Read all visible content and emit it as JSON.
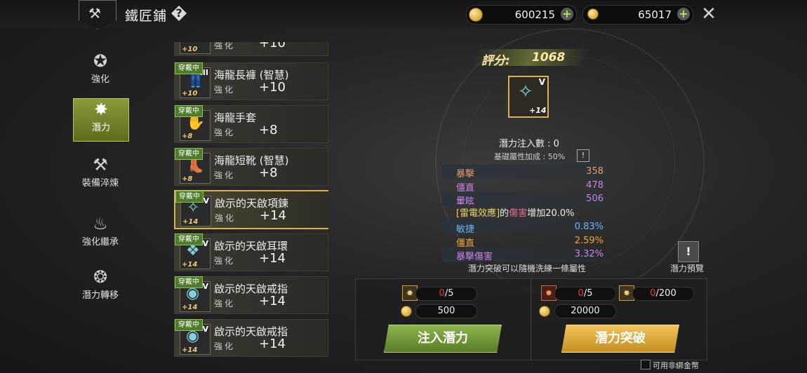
{
  "header": {
    "title": "鐵匠鋪",
    "help": "?",
    "gold": "600215",
    "gold_plus": "+",
    "gem": "65017",
    "gem_plus": "+"
  },
  "nav": [
    {
      "label": "強化",
      "icon": "enhance-icon"
    },
    {
      "label": "潛力",
      "icon": "potential-icon"
    },
    {
      "label": "裝備淬煉",
      "icon": "anvil-icon"
    },
    {
      "label": "強化繼承",
      "icon": "inherit-icon"
    },
    {
      "label": "潛力轉移",
      "icon": "transfer-icon"
    }
  ],
  "items": [
    {
      "tag": "",
      "name": "",
      "sub": "強化",
      "val": "+10",
      "lv": "+10",
      "tier": ""
    },
    {
      "tag": "穿戴中",
      "name": "海龍長褲 (智慧)",
      "sub": "強化",
      "val": "+10",
      "lv": "+10",
      "tier": "III"
    },
    {
      "tag": "穿戴中",
      "name": "海龍手套",
      "sub": "強化",
      "val": "+8",
      "lv": "+8",
      "tier": ""
    },
    {
      "tag": "穿戴中",
      "name": "海龍短靴 (智慧)",
      "sub": "強化",
      "val": "+8",
      "lv": "+8",
      "tier": ""
    },
    {
      "tag": "穿戴中",
      "name": "啟示的天啟項鍊",
      "sub": "強化",
      "val": "+14",
      "lv": "+14",
      "tier": "V"
    },
    {
      "tag": "穿戴中",
      "name": "啟示的天啟耳環",
      "sub": "強化",
      "val": "+14",
      "lv": "+14",
      "tier": "V"
    },
    {
      "tag": "穿戴中",
      "name": "啟示的天啟戒指",
      "sub": "強化",
      "val": "+14",
      "lv": "+14",
      "tier": "V"
    },
    {
      "tag": "穿戴中",
      "name": "啟示的天啟戒指",
      "sub": "強化",
      "val": "+14",
      "lv": "+14",
      "tier": "V"
    }
  ],
  "detail": {
    "score_label": "評分:",
    "score_value": "1068",
    "item_level": "+14",
    "item_tier": "V",
    "inject_count": "潛力注入數 : 0",
    "base_bonus": "基礎屬性加成 : 50%",
    "info": "!",
    "base_stats": [
      {
        "name": "暴擊",
        "value": "358",
        "color": "#e49a6a"
      },
      {
        "name": "僵直",
        "value": "478",
        "color": "#c783e6"
      },
      {
        "name": "暈眩",
        "value": "506",
        "color": "#c783e6"
      }
    ],
    "effect": {
      "bracket_open": "[",
      "skill": "雷電效應",
      "bracket_close": "]",
      "mid": "的",
      "dmg": "傷害",
      "tail": "增加20.0%"
    },
    "potential_stats": [
      {
        "name": "敏捷",
        "value": "0.83%",
        "color": "#6fb2ea"
      },
      {
        "name": "僵直",
        "value": "2.59%",
        "color": "#f2a23c"
      },
      {
        "name": "暴擊傷害",
        "value": "3.32%",
        "color": "#c783e6"
      }
    ],
    "reroll_note": "潛力突破可以隨機洗練一條屬性",
    "preview_icon": "!",
    "preview_label": "潛力預覽"
  },
  "inject": {
    "mat_current": "0",
    "mat_total": "/5",
    "cost": "500",
    "button": "注入潛力"
  },
  "breakthrough": {
    "mat1_current": "0",
    "mat1_total": "/5",
    "mat2_current": "0",
    "mat2_total": "/200",
    "cost": "20000",
    "button": "潛力突破"
  },
  "footer": {
    "unbound_label": "可用非綁金幣"
  }
}
